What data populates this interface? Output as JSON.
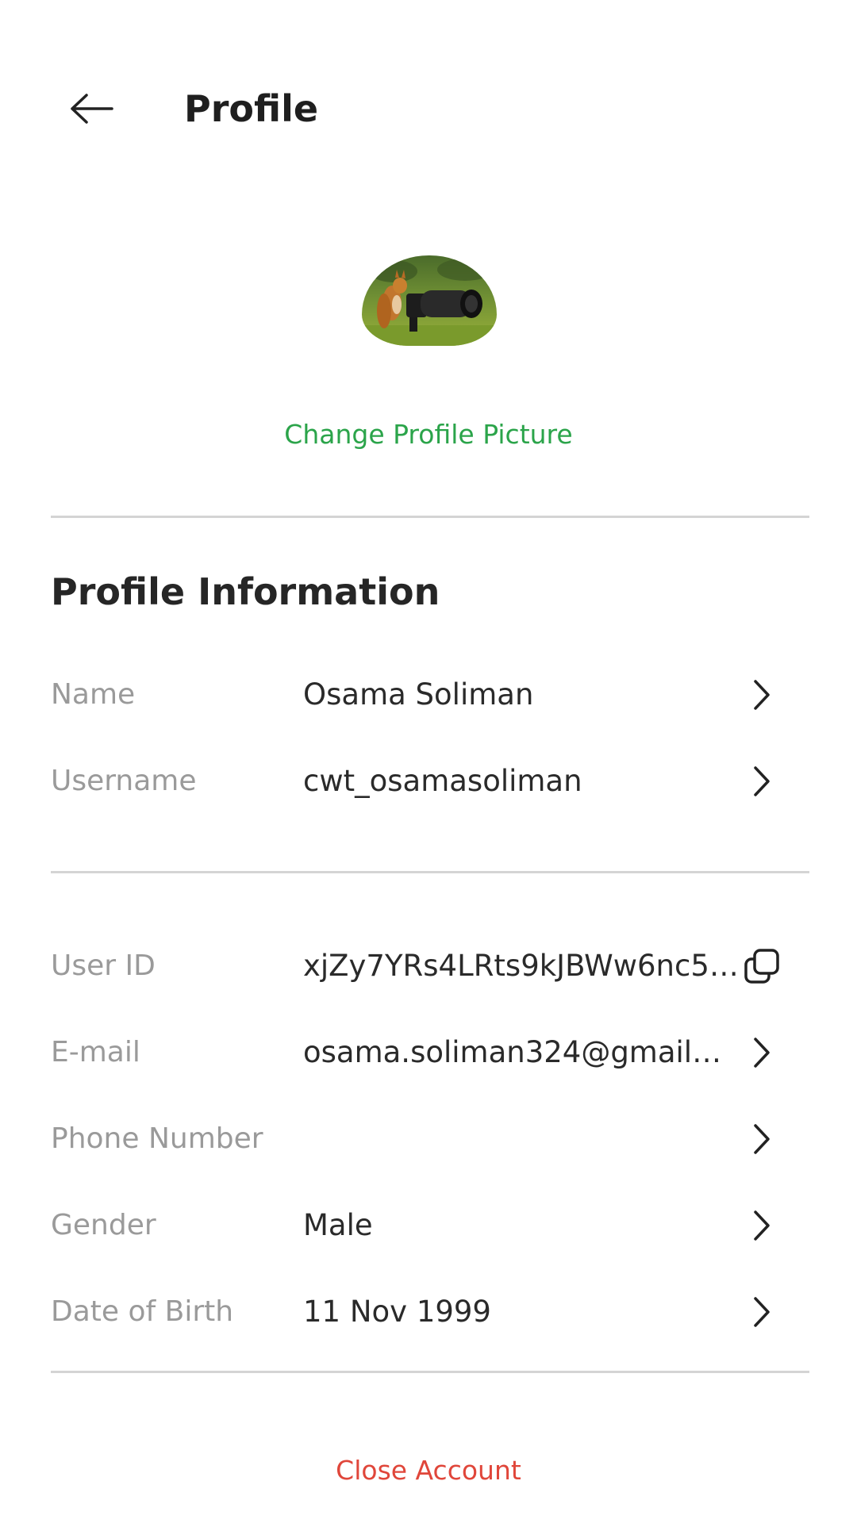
{
  "header": {
    "back_icon": "arrow-left-icon",
    "title": "Profile"
  },
  "avatar": {
    "description_icon": "avatar-photo"
  },
  "change_picture_label": "Change Profile Picture",
  "profile_info": {
    "title": "Profile Information",
    "rows": [
      {
        "label": "Name",
        "value": "Osama Soliman",
        "icon": "chevron-right-icon"
      },
      {
        "label": "Username",
        "value": "cwt_osamasoliman",
        "icon": "chevron-right-icon"
      }
    ]
  },
  "account_info": {
    "rows": [
      {
        "label": "User ID",
        "value": "xjZy7YRs4LRts9kJBWw6nc5…",
        "icon": "copy-icon"
      },
      {
        "label": "E-mail",
        "value": "osama.soliman324@gmail…",
        "icon": "chevron-right-icon"
      },
      {
        "label": "Phone Number",
        "value": "",
        "icon": "chevron-right-icon"
      },
      {
        "label": "Gender",
        "value": "Male",
        "icon": "chevron-right-icon"
      },
      {
        "label": "Date of Birth",
        "value": "11 Nov 1999",
        "icon": "chevron-right-icon"
      }
    ]
  },
  "close_account_label": "Close Account",
  "colors": {
    "accent_green": "#2ba44a",
    "danger_red": "#e0463a",
    "label_gray": "#9a9a9a",
    "divider": "#d4d4d4"
  }
}
